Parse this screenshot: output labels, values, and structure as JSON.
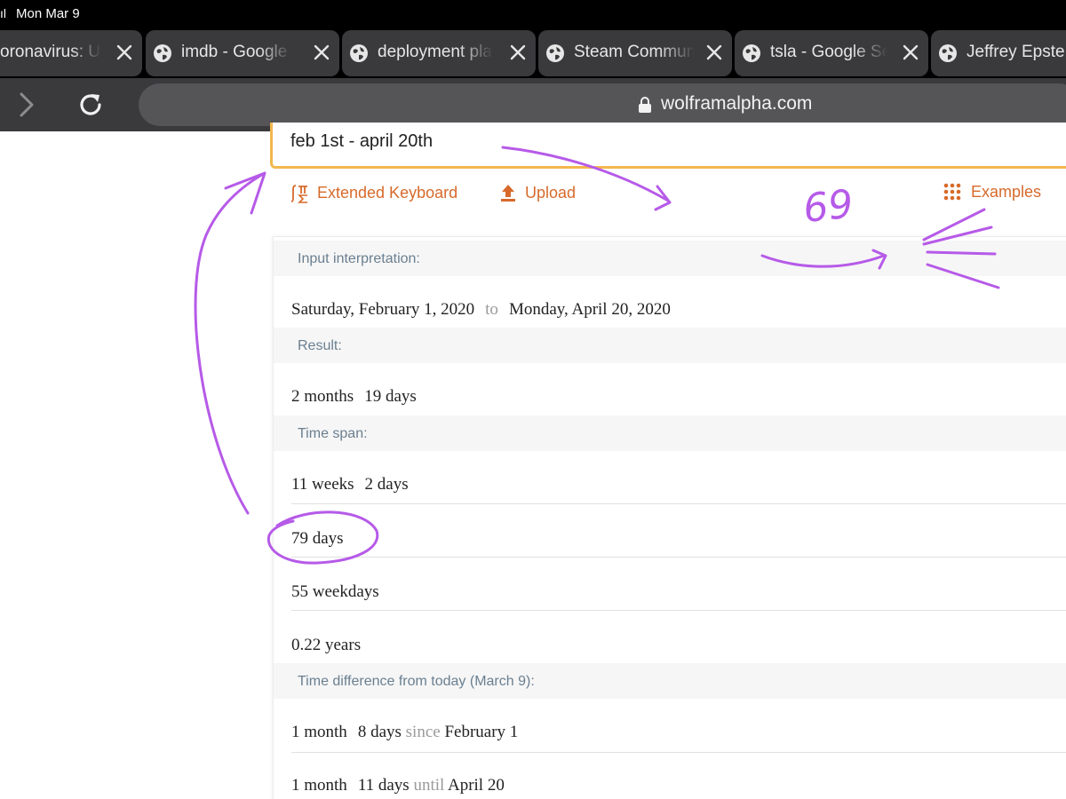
{
  "status_bar": {
    "signal": "ıl",
    "datetime": "Mon Mar 9"
  },
  "tabs": [
    {
      "title": "oronavirus: US"
    },
    {
      "title": "imdb - Google S"
    },
    {
      "title": "deployment plag"
    },
    {
      "title": "Steam Communi"
    },
    {
      "title": "tsla - Google Sea"
    },
    {
      "title": "Jeffrey Epste"
    }
  ],
  "toolbar": {
    "url": "wolframalpha.com"
  },
  "search": {
    "query": "feb 1st - april 20th"
  },
  "actions": {
    "keyboard": "Extended Keyboard",
    "upload": "Upload",
    "examples": "Examples"
  },
  "pods": {
    "input": {
      "title": "Input interpretation:",
      "from": "Saturday, February 1, 2020",
      "sep": "to",
      "to": "Monday, April 20, 2020"
    },
    "result": {
      "title": "Result:",
      "a": "2 months",
      "b": "19 days"
    },
    "timespan": {
      "title": "Time span:",
      "weeks_a": "11 weeks",
      "weeks_b": "2 days",
      "days": "79 days",
      "weekdays": "55 weekdays",
      "years": "0.22 years"
    },
    "diff": {
      "title": "Time difference from today (March 9):",
      "r1": {
        "a": "1 month",
        "b": "8 days",
        "rel": "since",
        "date": "February 1"
      },
      "r2": {
        "a": "1 month",
        "b": "11 days",
        "rel": "until",
        "date": "April 20"
      }
    }
  },
  "annotations": {
    "note": "69"
  },
  "colors": {
    "accent": "#d76a2b",
    "highlight": "#f2b74e",
    "ink": "#b65ae8",
    "pod_title": "#6a7f90"
  }
}
